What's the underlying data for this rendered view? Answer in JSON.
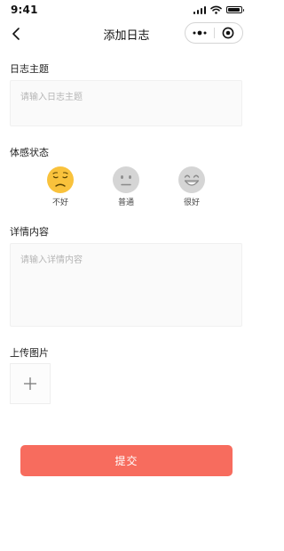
{
  "status_bar": {
    "time": "9:41",
    "battery_level": 0.9
  },
  "nav": {
    "title": "添加日志"
  },
  "topic": {
    "label": "日志主题",
    "placeholder": "请输入日志主题"
  },
  "mood": {
    "label": "体感状态",
    "options": [
      {
        "caption": "不好",
        "icon": "sad-face-icon",
        "color": "#f9c23c"
      },
      {
        "caption": "普通",
        "icon": "neutral-face-icon",
        "color": "#d5d5d5"
      },
      {
        "caption": "很好",
        "icon": "happy-face-icon",
        "color": "#d5d5d5"
      }
    ]
  },
  "details": {
    "label": "详情内容",
    "placeholder": "请输入详情内容"
  },
  "upload": {
    "label": "上传图片"
  },
  "submit": {
    "label": "提交"
  },
  "colors": {
    "accent": "#f76c5e",
    "selected_mood": "#f9c23c",
    "unselected_mood": "#d5d5d5"
  }
}
